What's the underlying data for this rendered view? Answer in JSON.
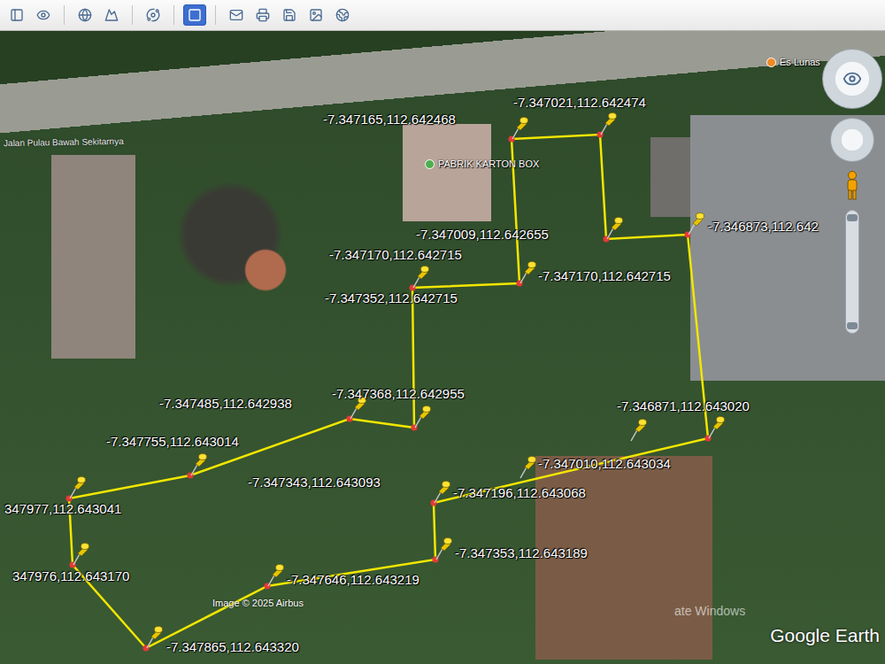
{
  "toolbar": {
    "buttons": [
      {
        "kind": "sidebar",
        "selected": false
      },
      {
        "kind": "tour",
        "selected": false
      },
      {
        "kind": "earth",
        "selected": false
      },
      {
        "kind": "terrain",
        "selected": false
      },
      {
        "kind": "planets",
        "selected": false
      },
      {
        "kind": "panel",
        "selected": true
      },
      {
        "kind": "email",
        "selected": false
      },
      {
        "kind": "print",
        "selected": false
      },
      {
        "kind": "save",
        "selected": false
      },
      {
        "kind": "image",
        "selected": false
      },
      {
        "kind": "globe",
        "selected": false
      }
    ]
  },
  "map": {
    "road_label": "Jalan Pulau Bawah Sekitarnya",
    "places": [
      {
        "label": "PABRIK KARTON BOX",
        "color": "#4caf50"
      },
      {
        "label": "Es Lunas",
        "color": "#f08a24"
      }
    ],
    "pins": [
      {
        "label": "-7.347165,112.642468"
      },
      {
        "label": "-7.347021,112.642474"
      },
      {
        "label": "-7.347009,112.642655"
      },
      {
        "label": "-7.346873,112.642"
      },
      {
        "label": "-7.347170,112.642715"
      },
      {
        "label": "-7.347170,112.642715"
      },
      {
        "label": "-7.347352,112.642715"
      },
      {
        "label": "-7.346871,112.643020"
      },
      {
        "label": "-7.347010,112.643034"
      },
      {
        "label": "-7.347196,112.643068"
      },
      {
        "label": "-7.347343,112.643093"
      },
      {
        "label": "-7.347353,112.643189"
      },
      {
        "label": "-7.347646,112.643219"
      },
      {
        "label": "-7.347865,112.643320"
      },
      {
        "label": "347976,112.643170"
      },
      {
        "label": "347977,112.643041"
      },
      {
        "label": "-7.347755,112.643014"
      },
      {
        "label": "-7.347485,112.642938"
      },
      {
        "label": "-7.347368,112.642955"
      }
    ],
    "attribution": "Image © 2025 Airbus",
    "logo": "Google Earth",
    "watermark": "ate Windows"
  }
}
